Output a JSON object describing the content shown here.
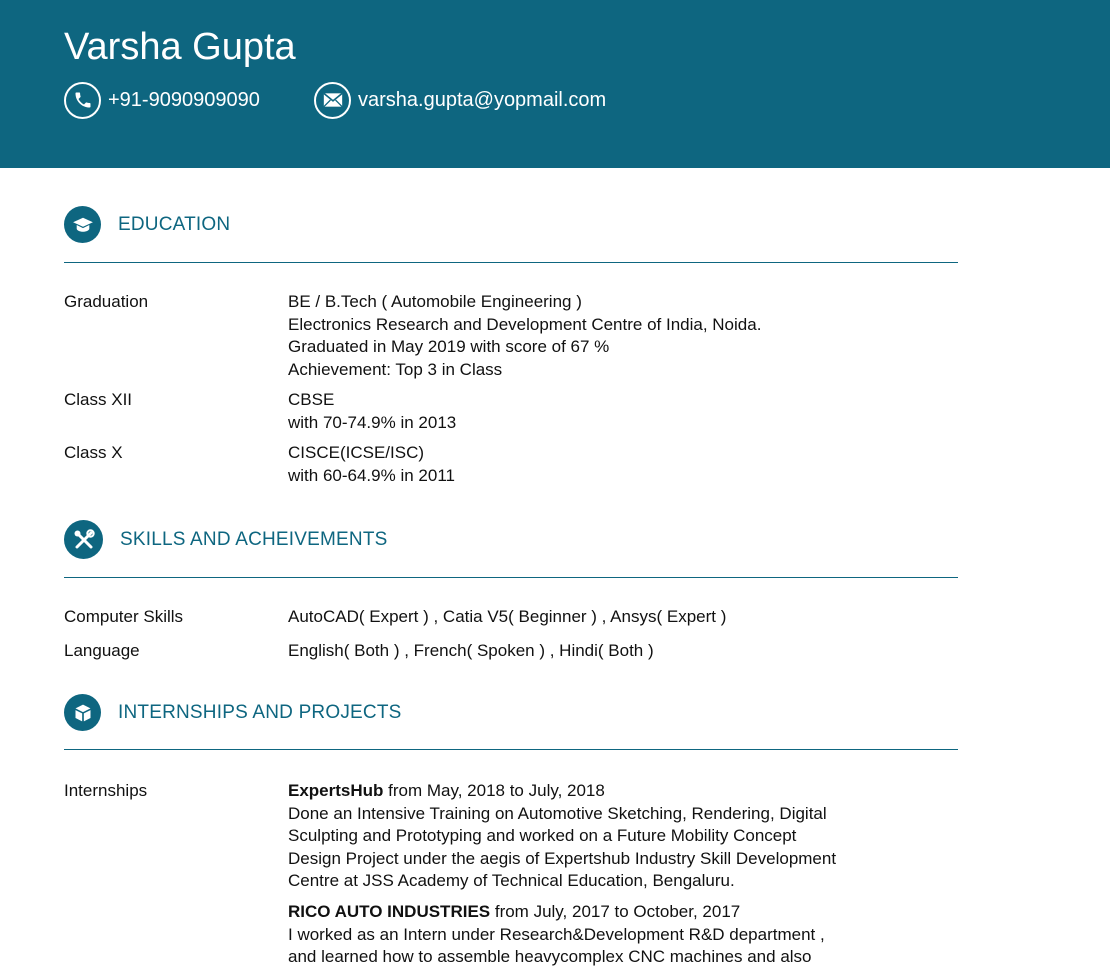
{
  "header": {
    "name": "Varsha Gupta",
    "phone": "+91-9090909090",
    "email": "varsha.gupta@yopmail.com",
    "phone_icon": "phone-icon",
    "email_icon": "envelope-icon",
    "background_color": "#0e6680"
  },
  "sections": {
    "education": {
      "title": "EDUCATION",
      "icon": "graduation-cap-icon",
      "rows": [
        {
          "label": "Graduation",
          "lines": [
            "BE / B.Tech ( Automobile Engineering )",
            "Electronics Research and Development Centre of India, Noida.",
            "Graduated in May 2019 with score of 67 %",
            "Achievement: Top 3 in Class"
          ]
        },
        {
          "label": "Class XII",
          "lines": [
            "CBSE",
            "with 70-74.9% in 2013"
          ]
        },
        {
          "label": "Class X",
          "lines": [
            "CISCE(ICSE/ISC)",
            "with 60-64.9% in 2011"
          ]
        }
      ]
    },
    "skills": {
      "title": "SKILLS AND ACHEIVEMENTS",
      "icon": "tools-icon",
      "rows": [
        {
          "label": "Computer Skills",
          "value": "AutoCAD( Expert ) , Catia V5( Beginner ) , Ansys( Expert )"
        },
        {
          "label": "Language",
          "value": "English( Both ) , French( Spoken ) , Hindi( Both )"
        }
      ]
    },
    "internships": {
      "title": "INTERNSHIPS AND PROJECTS",
      "icon": "cube-icon",
      "label": "Internships",
      "entries": [
        {
          "company": "ExpertsHub",
          "period": " from May, 2018 to July, 2018",
          "lines": [
            "Done an Intensive Training on Automotive Sketching, Rendering, Digital",
            "Sculpting and Prototyping and worked on a Future Mobility Concept",
            "Design Project under the aegis of Expertshub Industry Skill Development",
            "Centre at JSS Academy of Technical Education, Bengaluru."
          ]
        },
        {
          "company": "RICO AUTO INDUSTRIES",
          "period": " from July, 2017 to October, 2017",
          "lines": [
            "I worked as an Intern under Research&Development R&D department ,",
            "and learned how to assemble heavycomplex CNC machines and also"
          ]
        }
      ]
    }
  }
}
